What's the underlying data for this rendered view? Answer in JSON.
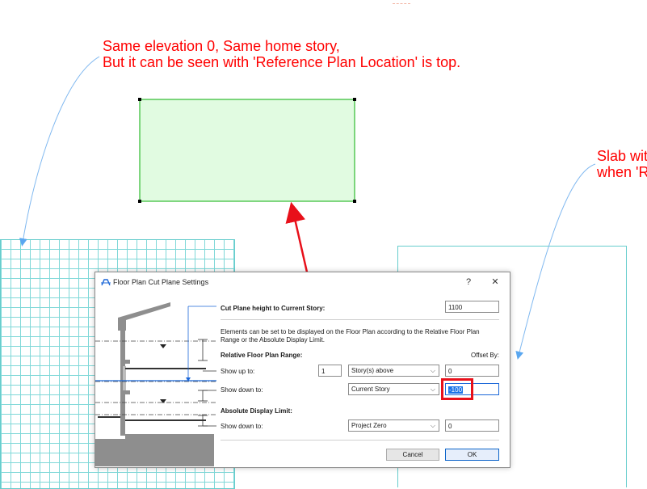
{
  "annotations": {
    "note_left_line1": "Same elevation 0, Same home story,",
    "note_left_line2": "But it can be seen with 'Reference Plan Location' is top.",
    "note_right_line1": "Slab wit",
    "note_right_line2": "when 'R"
  },
  "dialog": {
    "title": "Floor Plan Cut Plane Settings",
    "help_label": "?",
    "close_label": "✕",
    "cut_plane_label": "Cut Plane height to Current Story:",
    "cut_plane_value": "1100",
    "description": "Elements can be set to be displayed on the Floor Plan according to the Relative Floor Plan Range or the Absolute Display Limit.",
    "relative_range_heading": "Relative Floor Plan Range:",
    "offset_by_label": "Offset By:",
    "show_up_to_label": "Show up to:",
    "show_up_to_count": "1",
    "show_up_to_select": "Story(s) above",
    "show_up_to_offset": "0",
    "show_down_to_label": "Show down to:",
    "show_down_to_select": "Current Story",
    "show_down_to_offset": "-100",
    "absolute_limit_heading": "Absolute Display Limit:",
    "abs_show_down_to_label": "Show down to:",
    "abs_show_down_to_select": "Project Zero",
    "abs_show_down_to_offset": "0",
    "cancel_label": "Cancel",
    "ok_label": "OK"
  },
  "colors": {
    "annotation_red": "#ff0000",
    "slab_fill": "#e1fbe1",
    "slab_border": "#2fba2f",
    "brick_line": "#7fd8d8",
    "guide_blue": "#1b67d8"
  },
  "icons": {
    "dialog_icon": "cut-plane-icon",
    "dropdown": "chevron-down-icon"
  }
}
